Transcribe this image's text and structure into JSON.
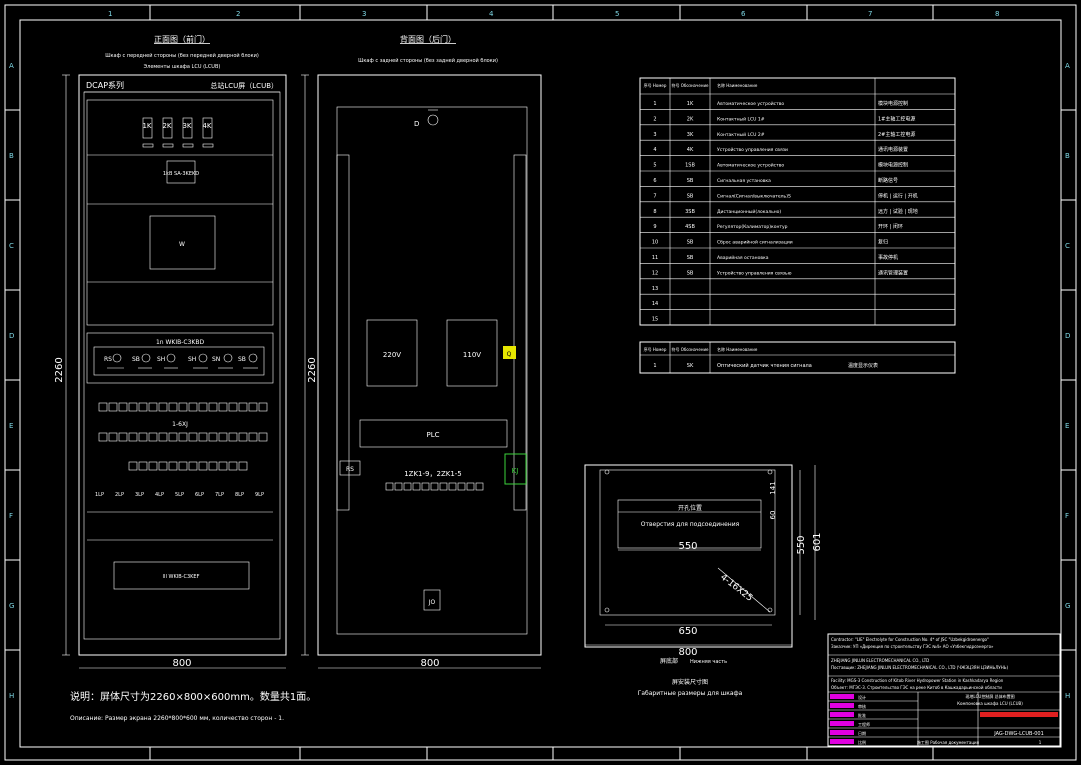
{
  "frame": {
    "columns": [
      "1",
      "2",
      "3",
      "4",
      "5",
      "6",
      "7",
      "8"
    ],
    "rows": [
      "A",
      "B",
      "C",
      "D",
      "E",
      "F",
      "G",
      "H"
    ]
  },
  "front_view": {
    "title": "正面图（前门）",
    "subtitle_ru": "Шкаф с передней стороны (без передней дверной блоки)",
    "subtitle2_ru": "Элементы шкафа LCU (LCUB)",
    "series_label": "DCAP系列",
    "panel_label": "总站LCU屏（LCUB）",
    "breakers": [
      "1K",
      "2K",
      "3K",
      "4K"
    ],
    "switch": "1kB\nSA-3KEKD",
    "screen": "W",
    "label_strip": "1n  WKIB-C3KBD",
    "indicators": [
      "RS",
      "SB",
      "SH",
      "SH",
      "SN",
      "SB",
      "SB"
    ],
    "terminal_label": "1-6XJ",
    "relays": [
      "1LP",
      "2LP",
      "3LP",
      "4LP",
      "5LP",
      "6LP",
      "7LP",
      "8LP",
      "9LP"
    ],
    "plate": "III\nWKIB-C3KEF",
    "height_dim": "2260",
    "width_dim": "800"
  },
  "rear_view": {
    "title": "背面图（后门）",
    "subtitle_ru": "Шкаф с задней стороны (без задней дверной блоки)",
    "lamp": "D",
    "box1": "220V",
    "box2": "110V",
    "plc": "PLC",
    "terminal": "1ZK1-9，2ZK1-5",
    "small_left": "RS",
    "yellow": "Q",
    "green": "KJ",
    "bottom": "JO",
    "height_dim": "2260",
    "width_dim": "800"
  },
  "note": {
    "cn": "说明：屏体尺寸为2260×800×600mm。数量共1面。",
    "ru": "Описание: Размер экрана 2260*800*600 мм, количество сторон - 1."
  },
  "parts_table": {
    "headers": [
      "序号\nНомер",
      "符号\nОбозначение",
      "名称\nНаименование",
      ""
    ],
    "rows": [
      [
        "1",
        "1K",
        "Автоматическое устройство",
        "模块电源控制"
      ],
      [
        "2",
        "2K",
        "Контактный LCU 1#",
        "1#主轴工控电源"
      ],
      [
        "3",
        "3K",
        "Контактный LCU 2#",
        "2#主轴工控电源"
      ],
      [
        "4",
        "4K",
        "Устройство управления связи",
        "通讯电源装置"
      ],
      [
        "5",
        "1SB",
        "Автоматическое устройство",
        "模块电源控制"
      ],
      [
        "6",
        "SB",
        "Сигнальная установка",
        "断路信号"
      ],
      [
        "7",
        "SB",
        "Сигнал(Сигнал/выключатель)S",
        "停机 | 运行 | 开机"
      ],
      [
        "8",
        "3SB",
        "Дистанционный(локально)",
        "远方 | 试验 | 现地"
      ],
      [
        "9",
        "4SB",
        "Регулятор(Калиматор)контур",
        "开环 | 闭环"
      ],
      [
        "10",
        "SB",
        "Сброс аварийной сигнализации",
        "复归"
      ],
      [
        "11",
        "SB",
        "Аварийная остановка",
        "事故停机"
      ],
      [
        "12",
        "SB",
        "Устройство управления связью",
        "通讯管理装置"
      ],
      [
        "13",
        "",
        "",
        " "
      ],
      [
        "14",
        "",
        "",
        " "
      ],
      [
        "15",
        "",
        "",
        " "
      ]
    ],
    "row2": [
      "1",
      "SK",
      "Оптический датчик чтения сигнала",
      "温度显示仪表"
    ]
  },
  "cutout": {
    "title": "开孔位置",
    "subtitle_ru": "Отверстия для подсоединения",
    "d1": "550",
    "d2": "550",
    "d3": "601",
    "d4": "4-16X25",
    "d5": "650",
    "d6": "800",
    "d7": "141",
    "d8": "60",
    "label_top": "屏安装尺寸图",
    "label_ru": "Габаритные размеры для шкафа",
    "floor_label": "屏底部",
    "floor_ru": "Нижняя часть"
  },
  "title_block": {
    "contractor": "Contractor: \"LIE\" Electrolyte for Construction No. 4* of JSC \"Uzbekgidroenergo\"",
    "contractor_ru": "Заказчик: УП «Дирекция по строительству ГЭС №4» АО «Узбекгидроэнерго»",
    "supplier": "ZHEJIANG JINLUN ELECTROMECHANICAL CO., LTD",
    "supplier_ru": "Поставщик: ZHEJIANG JINLUN ELECTROMECHANICAL CO., LTD (ЧЖЭЦЗЯН ЦЗИНЬЛУНЬ)",
    "facility": "Facility: MGS-3 Construction of Kitob River Hydropower Station in Kashkadarya Region",
    "facility_ru": "Объект: МГЭС-3. Строительство ГЭС на реке Китоб в Кашкадарьинской области",
    "project": "现地LCU控制屏 总体布置图",
    "project_ru": "Компоновка шкафа LCU (LCUB)",
    "rows": [
      "设计",
      "审核",
      "批准",
      "工程师",
      "日期",
      "比例"
    ],
    "doc_no": "JAG-DWG-LCUB-001",
    "stage": "施工图 Рабочая документация",
    "sheet": "1"
  }
}
